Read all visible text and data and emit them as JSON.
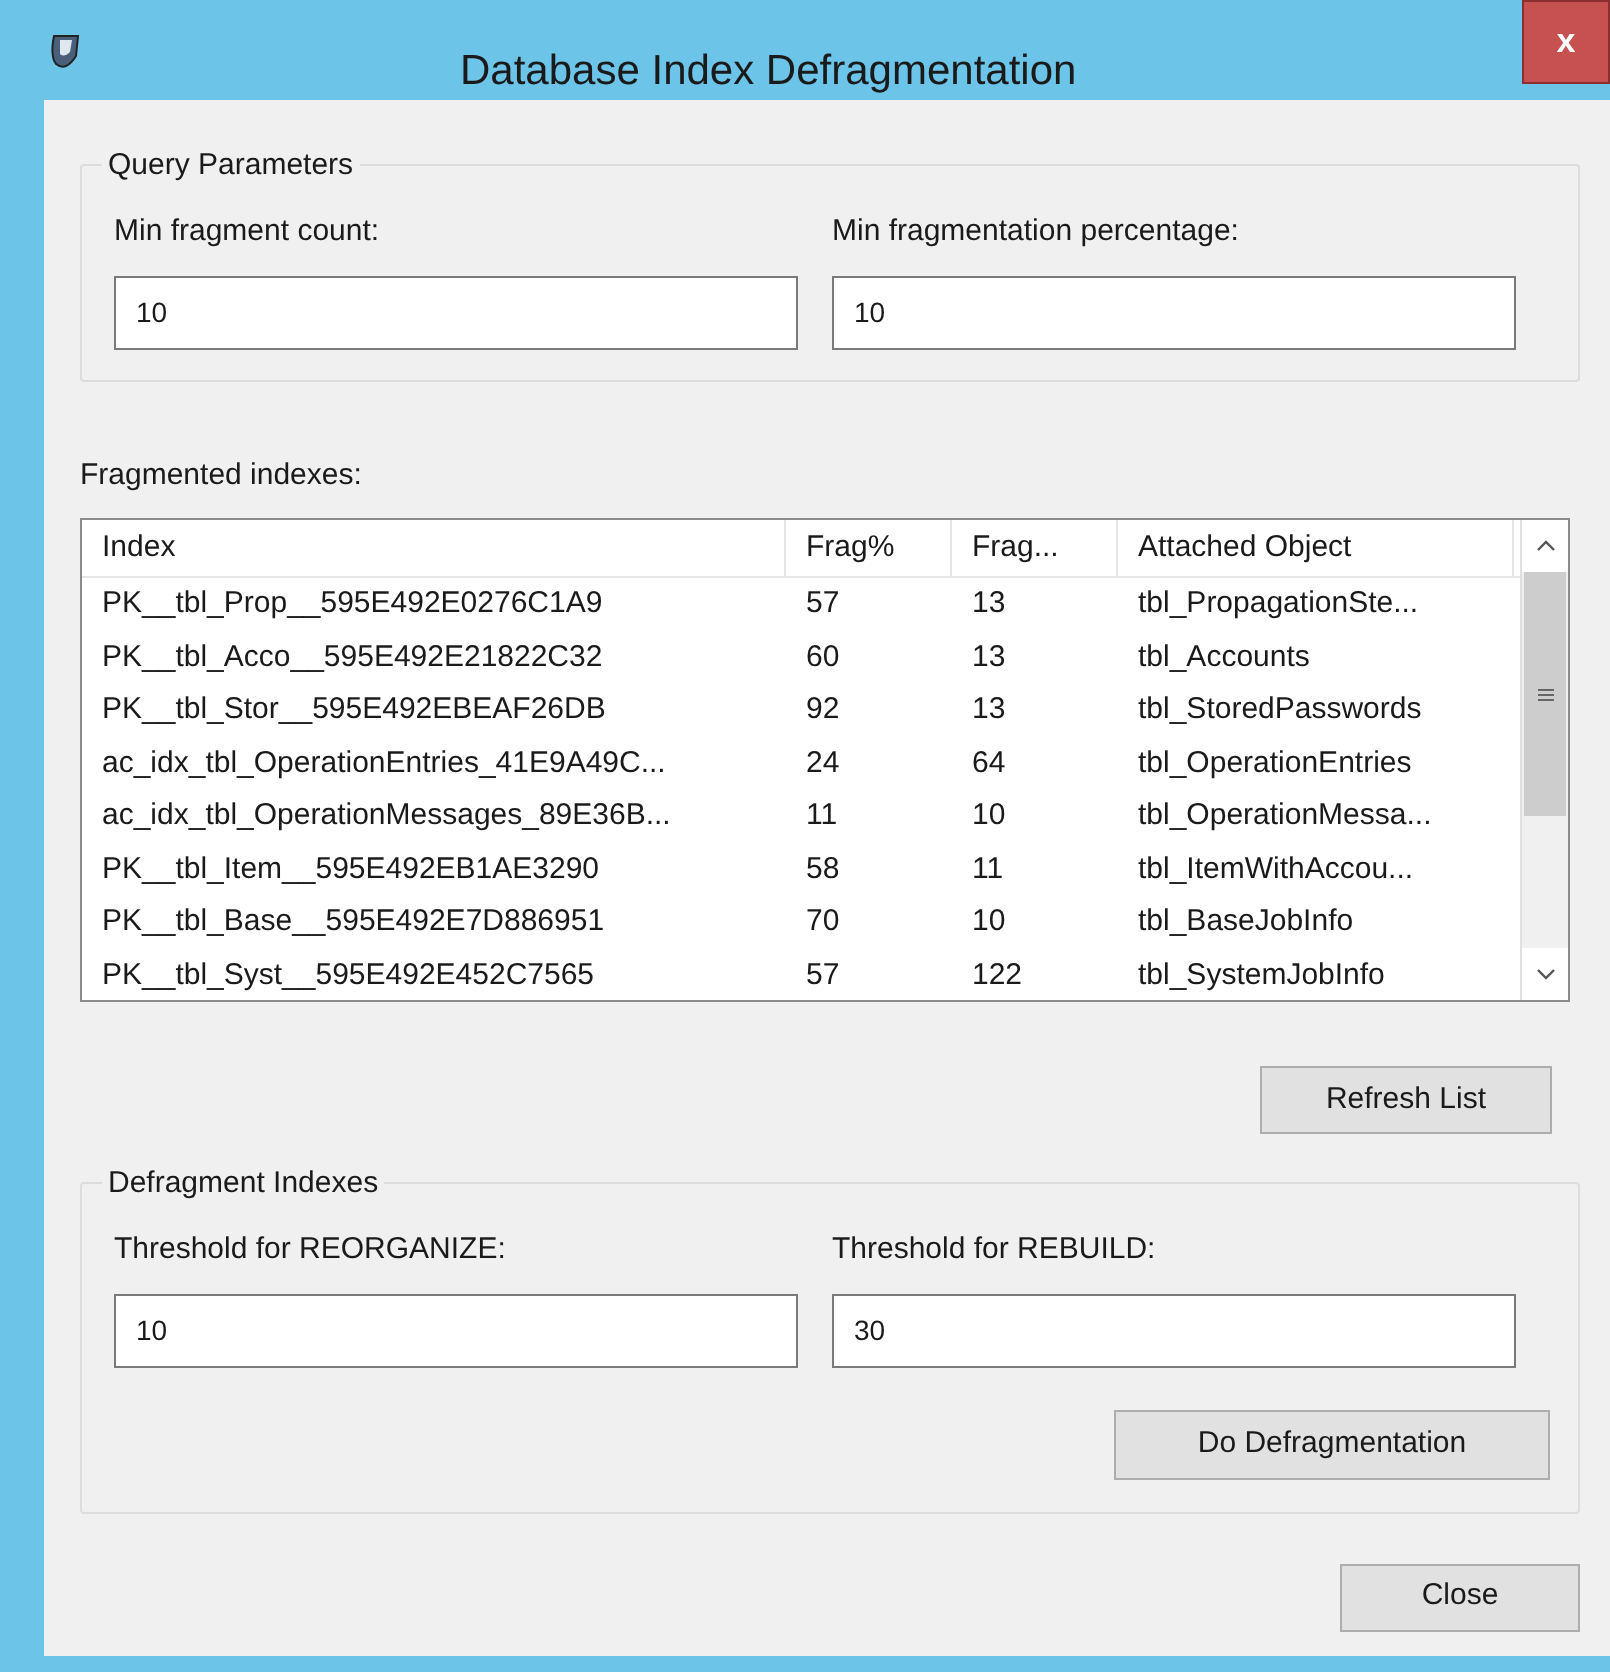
{
  "window": {
    "title": "Database Index Defragmentation",
    "close_glyph": "x"
  },
  "query_parameters": {
    "title": "Query Parameters",
    "fields": [
      {
        "label": "Min fragment count:",
        "value": "10"
      },
      {
        "label": "Min fragmentation percentage:",
        "value": "10"
      }
    ]
  },
  "fragmented_indexes": {
    "label": "Fragmented indexes:",
    "columns": [
      "Index",
      "Frag%",
      "Frag...",
      "Attached Object"
    ],
    "rows": [
      [
        "PK__tbl_Prop__595E492E0276C1A9",
        "57",
        "13",
        "tbl_PropagationSte..."
      ],
      [
        "PK__tbl_Acco__595E492E21822C32",
        "60",
        "13",
        "tbl_Accounts"
      ],
      [
        "PK__tbl_Stor__595E492EBEAF26DB",
        "92",
        "13",
        "tbl_StoredPasswords"
      ],
      [
        "ac_idx_tbl_OperationEntries_41E9A49C...",
        "24",
        "64",
        "tbl_OperationEntries"
      ],
      [
        "ac_idx_tbl_OperationMessages_89E36B...",
        "11",
        "10",
        "tbl_OperationMessa..."
      ],
      [
        "PK__tbl_Item__595E492EB1AE3290",
        "58",
        "11",
        "tbl_ItemWithAccou..."
      ],
      [
        "PK__tbl_Base__595E492E7D886951",
        "70",
        "10",
        "tbl_BaseJobInfo"
      ],
      [
        "PK__tbl_Syst__595E492E452C7565",
        "57",
        "122",
        "tbl_SystemJobInfo"
      ]
    ]
  },
  "refresh_button": "Refresh List",
  "defragment_indexes": {
    "title": "Defragment Indexes",
    "fields": [
      {
        "label": "Threshold for REORGANIZE:",
        "value": "10"
      },
      {
        "label": "Threshold for REBUILD:",
        "value": "30"
      }
    ],
    "button": "Do Defragmentation"
  },
  "close_button": "Close"
}
